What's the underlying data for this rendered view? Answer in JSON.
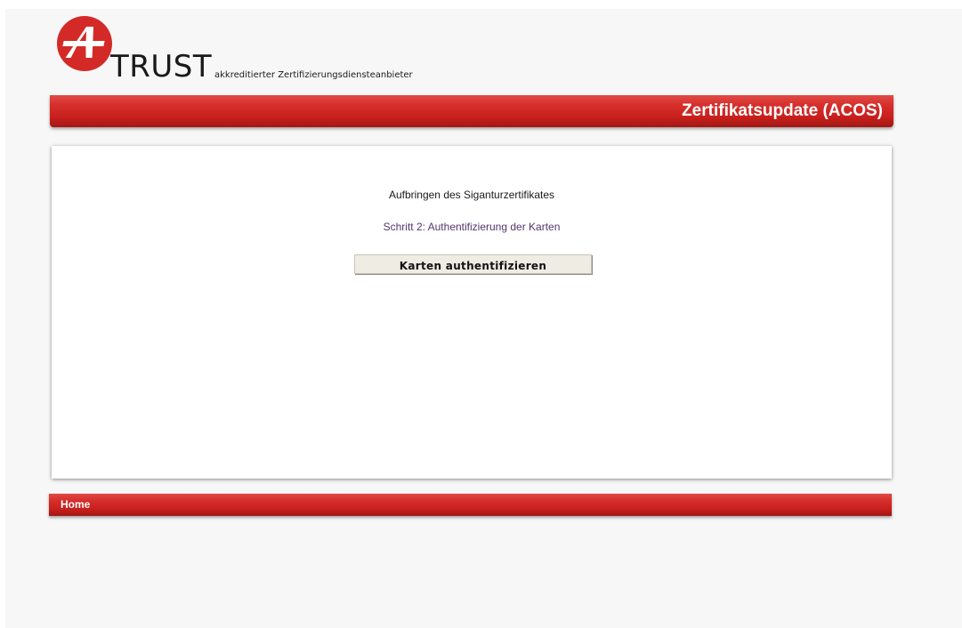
{
  "brand": {
    "logo_icon": "a-trust-logo-icon",
    "logo_text": "TRUST",
    "tagline": "akkreditierter Zertifizierungsdiensteanbieter",
    "accent_color": "#d42a27"
  },
  "header": {
    "title": "Zertifikatsupdate (ACOS)"
  },
  "content": {
    "heading": "Aufbringen des Siganturzertifikates",
    "step_text": "Schritt 2: Authentifizierung der Karten",
    "button_label": "Karten authentifizieren"
  },
  "footer": {
    "home_label": "Home"
  }
}
